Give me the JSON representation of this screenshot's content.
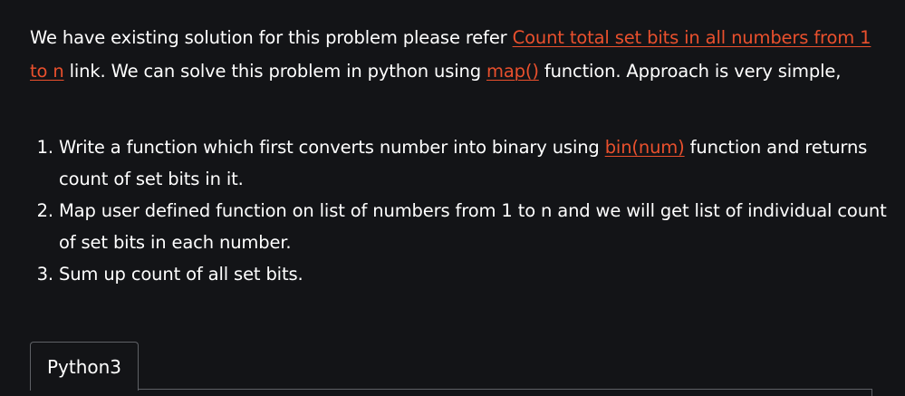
{
  "article": {
    "intro": {
      "text_before": "We have existing solution for this problem please refer ",
      "link1": "Count total set bits in all numbers from 1 to n",
      "text_middle": " link. We can solve this problem in python using ",
      "link2": "map()",
      "text_after": " function. Approach is very simple,"
    },
    "steps": [
      {
        "text_before": "Write a function which first converts number into binary using ",
        "link": "bin(num)",
        "text_after": " function and returns count of set bits in it."
      },
      {
        "text": "Map user defined function on list of numbers from 1 to n and we will get list of individual count of set bits in each number."
      },
      {
        "text": "Sum up count of all set bits."
      }
    ],
    "code_tabs": [
      {
        "label": "Python3"
      }
    ]
  },
  "colors": {
    "background": "#131417",
    "text": "#ffffff",
    "link": "#e9502d",
    "border": "#5f6166"
  }
}
